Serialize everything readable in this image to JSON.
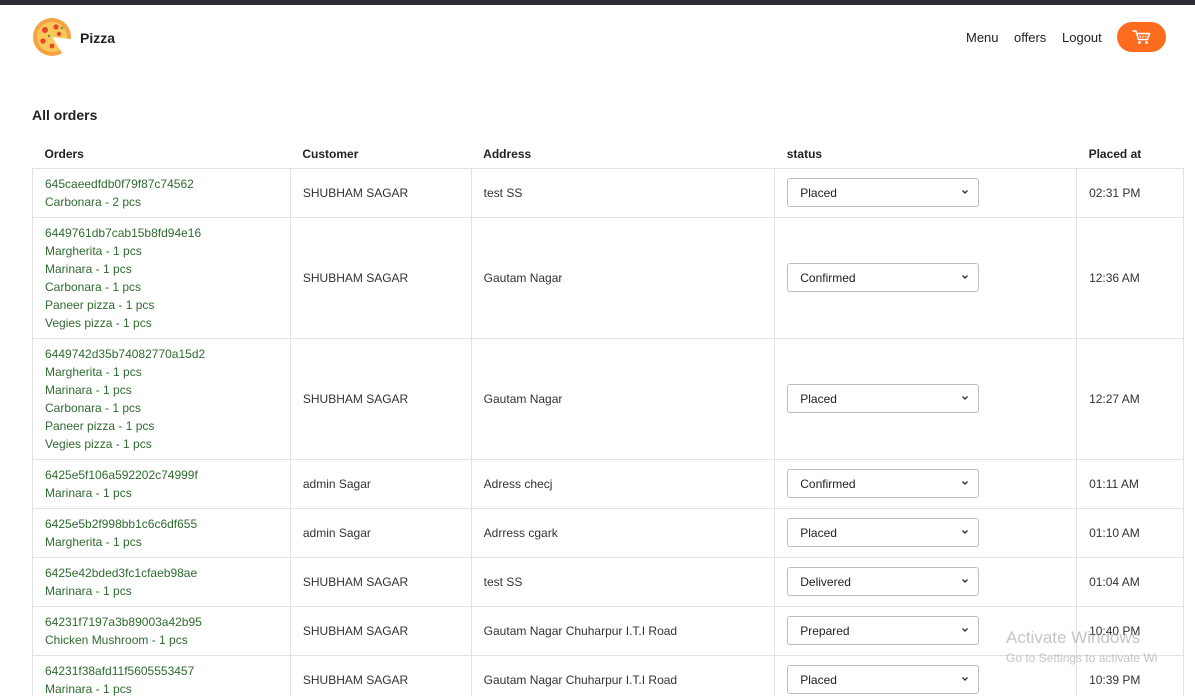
{
  "header": {
    "brand": "Pizza",
    "nav": [
      {
        "label": "Menu"
      },
      {
        "label": "offers"
      },
      {
        "label": "Logout"
      }
    ],
    "cart_icon": "cart-icon",
    "accent_color": "#fd6b1f"
  },
  "page": {
    "title": "All orders"
  },
  "table": {
    "headers": {
      "orders": "Orders",
      "customer": "Customer",
      "address": "Address",
      "status": "status",
      "placed_at": "Placed at"
    },
    "rows": [
      {
        "id": "645caeedfdb0f79f87c74562",
        "items": [
          "Carbonara - 2 pcs"
        ],
        "customer": "SHUBHAM SAGAR",
        "address": "test SS",
        "status": "Placed",
        "placed_at": "02:31 PM"
      },
      {
        "id": "6449761db7cab15b8fd94e16",
        "items": [
          "Margherita - 1 pcs",
          "Marinara - 1 pcs",
          "Carbonara - 1 pcs",
          "Paneer pizza - 1 pcs",
          "Vegies pizza - 1 pcs"
        ],
        "customer": "SHUBHAM SAGAR",
        "address": "Gautam Nagar",
        "status": "Confirmed",
        "placed_at": "12:36 AM"
      },
      {
        "id": "6449742d35b74082770a15d2",
        "items": [
          "Margherita - 1 pcs",
          "Marinara - 1 pcs",
          "Carbonara - 1 pcs",
          "Paneer pizza - 1 pcs",
          "Vegies pizza - 1 pcs"
        ],
        "customer": "SHUBHAM SAGAR",
        "address": "Gautam Nagar",
        "status": "Placed",
        "placed_at": "12:27 AM"
      },
      {
        "id": "6425e5f106a592202c74999f",
        "items": [
          "Marinara - 1 pcs"
        ],
        "customer": "admin Sagar",
        "address": "Adress checj",
        "status": "Confirmed",
        "placed_at": "01:11 AM"
      },
      {
        "id": "6425e5b2f998bb1c6c6df655",
        "items": [
          "Margherita - 1 pcs"
        ],
        "customer": "admin Sagar",
        "address": "Adrress cgark",
        "status": "Placed",
        "placed_at": "01:10 AM"
      },
      {
        "id": "6425e42bded3fc1cfaeb98ae",
        "items": [
          "Marinara - 1 pcs"
        ],
        "customer": "SHUBHAM SAGAR",
        "address": "test SS",
        "status": "Delivered",
        "placed_at": "01:04 AM"
      },
      {
        "id": "64231f7197a3b89003a42b95",
        "items": [
          "Chicken Mushroom - 1 pcs"
        ],
        "customer": "SHUBHAM SAGAR",
        "address": "Gautam Nagar Chuharpur I.T.I Road",
        "status": "Prepared",
        "placed_at": "10:40 PM"
      },
      {
        "id": "64231f38afd11f5605553457",
        "items": [
          "Marinara - 1 pcs"
        ],
        "customer": "SHUBHAM SAGAR",
        "address": "Gautam Nagar Chuharpur I.T.I Road",
        "status": "Placed",
        "placed_at": "10:39 PM"
      }
    ]
  },
  "watermark": {
    "title": "Activate Windows",
    "subtitle": "Go to Settings to activate Wi"
  }
}
